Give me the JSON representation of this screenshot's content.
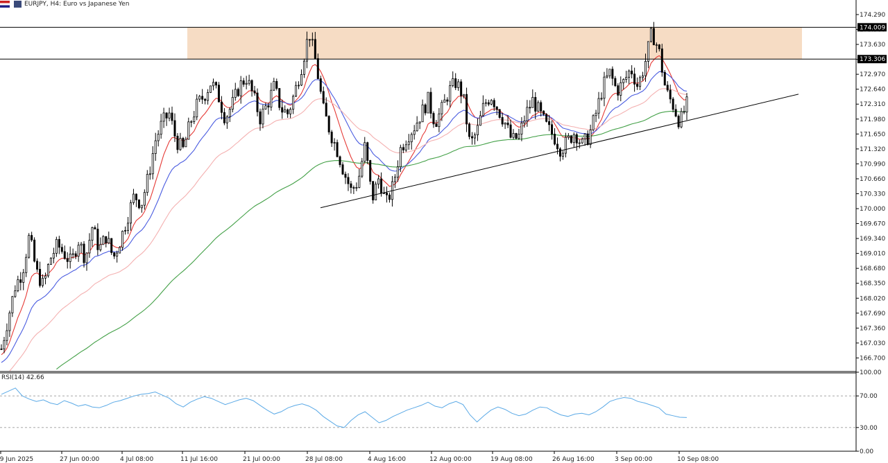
{
  "header": {
    "symbol": "EURJPY, H4:  Euro vs Japanese Yen"
  },
  "colors": {
    "background": "#ffffff",
    "candles": "#000000",
    "ema_red": "#e53935",
    "ema_blue": "#4a5ce0",
    "ema_pink": "#f4b0b0",
    "sma_green": "#43a047",
    "rsi_line": "#5aa9e6",
    "resistance_zone": "#f6dcc4",
    "trendline": "#000000"
  },
  "chart_data": [
    {
      "type": "candlestick",
      "title": "EURJPY, H4:  Euro vs Japanese Yen",
      "ylim": [
        166.4,
        174.29
      ],
      "yticks": [
        "174.290",
        "173.960",
        "173.630",
        "173.300",
        "172.970",
        "172.640",
        "172.310",
        "171.980",
        "171.650",
        "171.320",
        "170.990",
        "170.660",
        "170.330",
        "170.000",
        "169.670",
        "169.340",
        "169.010",
        "168.680",
        "168.350",
        "168.020",
        "167.690",
        "167.360",
        "167.030",
        "166.700"
      ],
      "xticks": [
        "19 Jun 2025",
        "27 Jun 00:00",
        "4 Jul 08:00",
        "11 Jul 16:00",
        "21 Jul 00:00",
        "28 Jul 08:00",
        "4 Aug 16:00",
        "12 Aug 00:00",
        "19 Aug 08:00",
        "26 Aug 16:00",
        "3 Sep 00:00",
        "10 Sep 08:00"
      ],
      "price_labels": [
        {
          "value": 174.009,
          "label": "174.009"
        },
        {
          "value": 173.306,
          "label": "173.306"
        }
      ],
      "resistance_zone": {
        "from": 173.306,
        "to": 174.009
      },
      "trendline": {
        "start": [
          "28 Jul",
          170.02
        ],
        "end": [
          "11 Sep",
          172.53
        ]
      },
      "close_path": [
        166.9,
        167.6,
        168.3,
        168.6,
        169.4,
        168.6,
        168.3,
        168.9,
        169.2,
        169.0,
        168.8,
        169.3,
        168.9,
        169.6,
        169.1,
        169.4,
        168.9,
        169.3,
        169.8,
        170.3,
        170.1,
        170.7,
        171.5,
        171.9,
        172.1,
        171.5,
        171.3,
        171.9,
        172.3,
        172.5,
        172.8,
        172.5,
        172.0,
        172.3,
        172.7,
        172.9,
        172.5,
        172.0,
        172.3,
        172.7,
        172.2,
        172.1,
        172.6,
        173.2,
        173.9,
        173.2,
        172.2,
        171.7,
        171.3,
        170.8,
        170.4,
        170.6,
        171.4,
        170.2,
        170.7,
        170.1,
        170.5,
        171.3,
        171.6,
        171.8,
        172.1,
        172.4,
        171.9,
        172.2,
        172.6,
        172.8,
        172.5,
        171.4,
        171.7,
        172.3,
        172.5,
        172.2,
        171.9,
        171.5,
        171.6,
        172.1,
        172.4,
        172.1,
        171.8,
        171.6,
        171.3,
        171.5,
        171.7,
        171.4,
        171.6,
        172.1,
        172.7,
        173.0,
        172.6,
        172.8,
        173.1,
        172.7,
        173.2,
        173.9,
        173.5,
        172.6,
        172.3,
        171.9,
        172.3
      ],
      "indicators": [
        {
          "name": "EMA fast",
          "color": "#e53935"
        },
        {
          "name": "EMA mid",
          "color": "#4a5ce0"
        },
        {
          "name": "EMA slow",
          "color": "#f4b0b0"
        },
        {
          "name": "SMA long",
          "color": "#43a047"
        }
      ]
    },
    {
      "type": "line",
      "title": "RSI(14) 42.66",
      "ylim": [
        0,
        100
      ],
      "yticks": [
        "100.00",
        "70.00",
        "30.00",
        "0.00"
      ],
      "levels": [
        70,
        30
      ],
      "series": [
        {
          "name": "RSI(14)",
          "values": [
            72,
            76,
            80,
            70,
            66,
            63,
            65,
            61,
            59,
            64,
            61,
            57,
            59,
            56,
            55,
            58,
            62,
            64,
            67,
            70,
            72,
            73,
            75,
            71,
            67,
            60,
            56,
            62,
            66,
            69,
            67,
            63,
            59,
            62,
            65,
            67,
            64,
            58,
            52,
            47,
            50,
            55,
            58,
            60,
            57,
            52,
            44,
            38,
            32,
            30,
            39,
            46,
            50,
            43,
            36,
            39,
            44,
            48,
            52,
            55,
            58,
            62,
            57,
            55,
            60,
            63,
            59,
            46,
            37,
            45,
            52,
            56,
            53,
            48,
            45,
            47,
            52,
            56,
            55,
            50,
            46,
            44,
            47,
            48,
            46,
            50,
            56,
            63,
            66,
            68,
            67,
            63,
            61,
            58,
            55,
            47,
            45,
            43,
            42.66
          ]
        }
      ]
    }
  ]
}
